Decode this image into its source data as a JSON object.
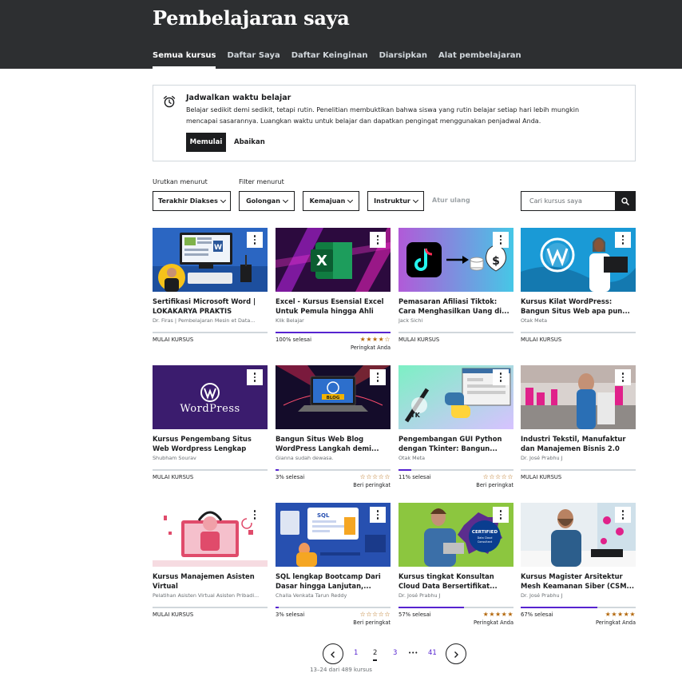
{
  "header": {
    "title": "Pembelajaran saya",
    "tabs": [
      {
        "label": "Semua kursus",
        "active": true
      },
      {
        "label": "Daftar Saya",
        "active": false
      },
      {
        "label": "Daftar Keinginan",
        "active": false
      },
      {
        "label": "Diarsipkan",
        "active": false
      },
      {
        "label": "Alat pembelajaran",
        "active": false
      }
    ]
  },
  "banner": {
    "title": "Jadwalkan waktu belajar",
    "text": "Belajar sedikit demi sedikit, tetapi rutin. Penelitian membuktikan bahwa siswa yang rutin belajar setiap hari lebih mungkin mencapai sasarannya. Luangkan waktu untuk belajar dan dapatkan pengingat menggunakan penjadwal Anda.",
    "primary_button": "Memulai",
    "secondary_button": "Abaikan",
    "icon": "alarm-clock-icon"
  },
  "filters": {
    "sort_label": "Urutkan menurut",
    "filter_label": "Filter menurut",
    "sort_value": "Terakhir Diakses",
    "category": "Golongan",
    "progress": "Kemajuan",
    "instructor": "Instruktur",
    "reset": "Atur ulang",
    "search_placeholder": "Cari kursus saya",
    "search_icon": "search-icon"
  },
  "courses": [
    {
      "title": "Sertifikasi Microsoft Word | LOKAKARYA PRAKTIS",
      "instructor": "Dr. Firas | Pembelajaran Mesin et Data...",
      "status": "MULAI KURSUS",
      "progress": 0,
      "stars": "",
      "rating_label": ""
    },
    {
      "title": "Excel - Kursus Esensial Excel Untuk Pemula hingga Ahli",
      "instructor": "Klik Belajar",
      "status": "100% selesai",
      "progress": 1.0,
      "stars": "★★★★☆",
      "rating_label": "Peringkat Anda"
    },
    {
      "title": "Pemasaran Afiliasi Tiktok: Cara Menghasilkan Uang di...",
      "instructor": "Jack Sichi",
      "status": "MULAI KURSUS",
      "progress": 0,
      "stars": "",
      "rating_label": ""
    },
    {
      "title": "Kursus Kilat WordPress: Bangun Situs Web apa pun...",
      "instructor": "Otak Meta",
      "status": "MULAI KURSUS",
      "progress": 0,
      "stars": "",
      "rating_label": ""
    },
    {
      "title": "Kursus Pengembang Situs Web Wordpress Lengkap",
      "instructor": "Shubham Sourav",
      "status": "MULAI KURSUS",
      "progress": 0,
      "stars": "",
      "rating_label": ""
    },
    {
      "title": "Bangun Situs Web Blog WordPress Langkah demi...",
      "instructor": "Gianna sudah dewasa.",
      "status": "3% selesai",
      "progress": 0.03,
      "stars": "☆☆☆☆☆",
      "rating_label": "Beri peringkat"
    },
    {
      "title": "Pengembangan GUI Python dengan Tkinter: Bangun...",
      "instructor": "Otak Meta",
      "status": "11% selesai",
      "progress": 0.11,
      "stars": "☆☆☆☆☆",
      "rating_label": "Beri peringkat"
    },
    {
      "title": "Industri Tekstil, Manufaktur dan Manajemen Bisnis 2.0",
      "instructor": "Dr. José Prabhu J",
      "status": "MULAI KURSUS",
      "progress": 0,
      "stars": "",
      "rating_label": ""
    },
    {
      "title": "Kursus Manajemen Asisten Virtual",
      "instructor": "Pelatihan Asisten Virtual Asisten Pribadi...",
      "status": "MULAI KURSUS",
      "progress": 0,
      "stars": "",
      "rating_label": ""
    },
    {
      "title": "SQL lengkap Bootcamp Dari Dasar hingga Lanjutan,...",
      "instructor": "Challa Venkata Tarun Reddy",
      "status": "3% selesai",
      "progress": 0.03,
      "stars": "☆☆☆☆☆",
      "rating_label": "Beri peringkat"
    },
    {
      "title": "Kursus tingkat Konsultan Cloud Data Bersertifikat...",
      "instructor": "Dr. José Prabhu J",
      "status": "57% selesai",
      "progress": 0.57,
      "stars": "★★★★★",
      "rating_label": "Peringkat Anda"
    },
    {
      "title": "Kursus Magister Arsitektur Mesh Keamanan Siber (CSM...",
      "instructor": "Dr. José Prabhu J",
      "status": "67% selesai",
      "progress": 0.67,
      "stars": "★★★★★",
      "rating_label": "Peringkat Anda"
    }
  ],
  "thumbnail_text": {
    "wordpress": "WordPress",
    "certified_1": "CERTIFIED",
    "certified_2": "Data Cloud",
    "certified_3": "Consultant",
    "sql": "SQL",
    "tk": "TK",
    "blog": "BLOG",
    "excel": "X",
    "word": "W",
    "dollar": "$"
  },
  "pagination": {
    "pages": [
      "1",
      "2",
      "3",
      "•••",
      "41"
    ],
    "current": "2",
    "summary": "13–24 dari 489 kursus",
    "prev_icon": "chevron-left-icon",
    "next_icon": "chevron-right-icon"
  },
  "colors": {
    "header_bg": "#2d2f31",
    "accent_purple": "#5624d0",
    "star_gold": "#b4690e"
  }
}
